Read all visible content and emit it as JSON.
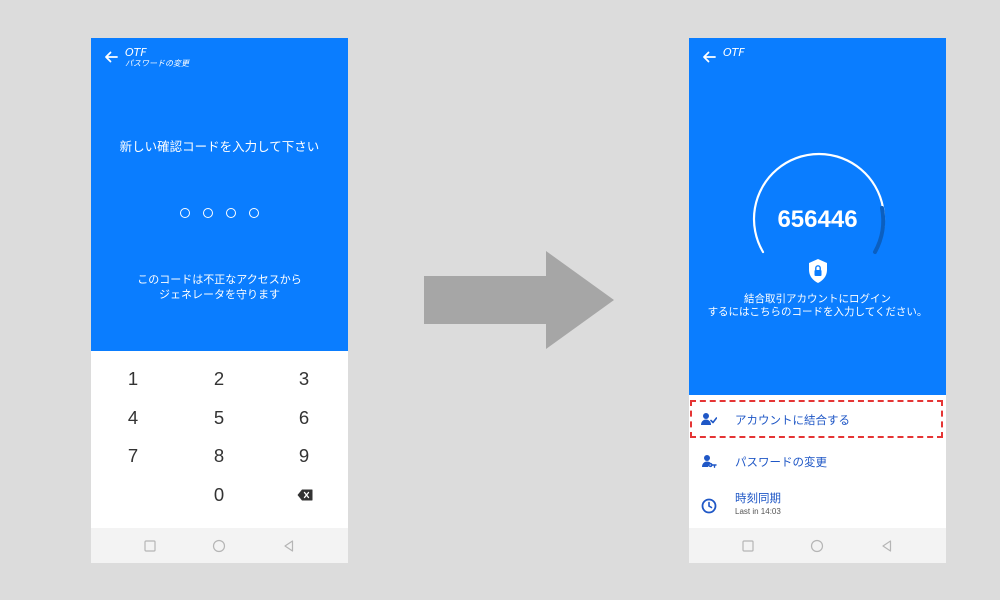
{
  "left_phone": {
    "app_title": "OTF",
    "app_subtitle": "パスワードの変更",
    "prompt": "新しい確認コードを入力して下さい",
    "pin_length": 4,
    "protect_text_line1": "このコードは不正なアクセスから",
    "protect_text_line2": "ジェネレータを守ります",
    "keys": [
      "1",
      "2",
      "3",
      "4",
      "5",
      "6",
      "7",
      "8",
      "9",
      "0"
    ]
  },
  "right_phone": {
    "app_title": "OTF",
    "otp_code": "656446",
    "instruction_line1": "結合取引アカウントにログイン",
    "instruction_line2": "するにはこちらのコードを入力してください。",
    "menu": {
      "link_account": "アカウントに結合する",
      "change_password": "パスワードの変更",
      "time_sync": "時刻同期",
      "time_sync_sub": "Last in 14:03"
    }
  },
  "colors": {
    "primary": "#0a7dff",
    "background": "#dcdcdc",
    "menu_text": "#1f57c6",
    "highlight": "#e53535",
    "arrow": "#a6a6a6"
  },
  "icons": [
    "back-arrow-icon",
    "backspace-icon",
    "shield-lock-icon",
    "link-user-icon",
    "key-user-icon",
    "clock-sync-icon",
    "square-nav-icon",
    "circle-nav-icon",
    "triangle-back-nav-icon"
  ]
}
